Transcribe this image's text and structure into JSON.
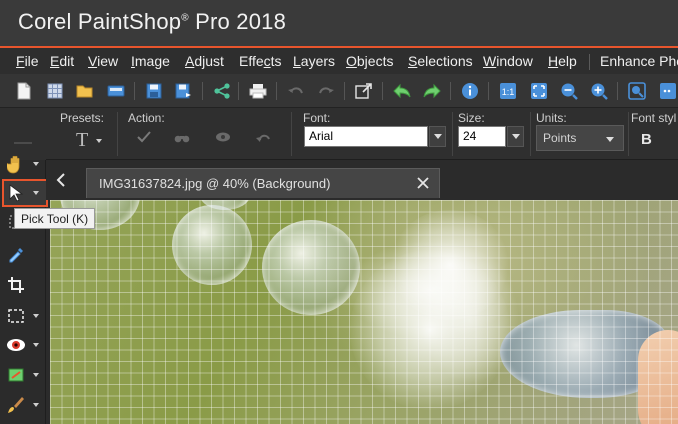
{
  "app": {
    "title_main": "Corel PaintShop",
    "title_reg": "®",
    "title_rest": " Pro 2018"
  },
  "menu": {
    "items": [
      {
        "key": "F",
        "rest": "ile"
      },
      {
        "key": "E",
        "rest": "dit"
      },
      {
        "key": "V",
        "rest": "iew"
      },
      {
        "key": "I",
        "rest": "mage"
      },
      {
        "key": "A",
        "rest": "djust"
      },
      {
        "key": "",
        "pre": "Effe",
        "key2": "c",
        "post": "ts"
      },
      {
        "key": "L",
        "rest": "ayers"
      },
      {
        "key": "O",
        "rest": "bjects"
      },
      {
        "key": "S",
        "rest": "elections"
      },
      {
        "key": "W",
        "rest": "indow"
      },
      {
        "key": "H",
        "rest": "elp"
      }
    ],
    "enhance": "Enhance Pho"
  },
  "options": {
    "presets_label": "Presets:",
    "action_label": "Action:",
    "font_label": "Font:",
    "font_value": "Arial",
    "size_label": "Size:",
    "size_value": "24",
    "units_label": "Units:",
    "units_value": "Points",
    "fontstyle_label": "Font styl",
    "bold_label": "B"
  },
  "tab": {
    "label": "IMG31637824.jpg @  40% (Background)"
  },
  "tooltip": {
    "text": "Pick Tool (K)"
  },
  "colors": {
    "accent": "#e8552d",
    "toolbar_bg": "#353535",
    "title_bg": "#3a3a3a"
  },
  "icons": {
    "toolbar": [
      "new-icon",
      "grid-icon",
      "open-folder-icon",
      "scanner-icon",
      "save-icon",
      "save-as-icon",
      "share-icon",
      "print-icon",
      "undo-icon",
      "redo-icon",
      "export-icon",
      "back-icon",
      "forward-icon",
      "info-icon",
      "actual-size-icon",
      "fit-icon",
      "zoom-out-icon",
      "zoom-in-icon",
      "zoom-fit-icon"
    ],
    "tools": [
      "pan-hand-icon",
      "pick-arrow-icon",
      "selection-icon",
      "dropper-icon",
      "crop-icon",
      "marquee-icon",
      "red-eye-icon",
      "straighten-icon",
      "brush-icon"
    ]
  }
}
